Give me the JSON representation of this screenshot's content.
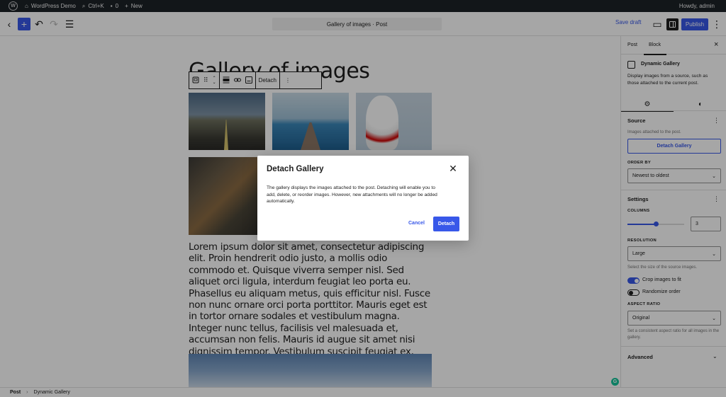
{
  "admin_bar": {
    "site_name": "WordPress Demo",
    "search_shortcut": "Ctrl+K",
    "comments_count": "0",
    "new_label": "New",
    "howdy": "Howdy, admin"
  },
  "header": {
    "document_title": "Gallery of images · Post",
    "save_draft": "Save draft",
    "publish": "Publish"
  },
  "canvas": {
    "post_title": "Gallery of images",
    "toolbar_detach": "Detach",
    "paragraph": "Lorem ipsum dolor sit amet, consectetur adipiscing elit. Proin hendrerit odio justo, a mollis odio commodo et. Quisque viverra semper nisl. Sed aliquet orci ligula, interdum feugiat leo porta eu. Phasellus eu aliquam metus, quis efficitur nisl. Fusce non nunc ornare orci porta porttitor. Mauris eget est in tortor ornare sodales et vestibulum magna. Integer nunc tellus, facilisis vel malesuada et, accumsan non felis. Mauris id augue sit amet nisi dignissim tempor. Vestibulum suscipit feugiat ex, tincidunt cursus neque. Fusce tempus elementum erat ac convallis."
  },
  "modal": {
    "title": "Detach Gallery",
    "body": "The gallery displays the images attached to the post. Detaching will enable you to add, delete, or reorder images. However, new attachments will no longer be added automatically.",
    "cancel": "Cancel",
    "confirm": "Detach"
  },
  "sidebar": {
    "tabs": [
      "Post",
      "Block"
    ],
    "active_tab": "Block",
    "block_name": "Dynamic Gallery",
    "block_description": "Display images from a source, such as those attached to the current post.",
    "source": {
      "title": "Source",
      "help": "Images attached to the post.",
      "detach_button": "Detach Gallery",
      "order_by_label": "ORDER BY",
      "order_by_value": "Newest to oldest"
    },
    "settings": {
      "title": "Settings",
      "columns_label": "COLUMNS",
      "columns_value": "3",
      "columns_fraction": 0.5,
      "resolution_label": "RESOLUTION",
      "resolution_value": "Large",
      "resolution_help": "Select the size of the source images.",
      "crop_label": "Crop images to fit",
      "crop_on": true,
      "randomize_label": "Randomize order",
      "randomize_on": false,
      "aspect_label": "ASPECT RATIO",
      "aspect_value": "Original",
      "aspect_help": "Set a consistent aspect ratio for all images in the gallery."
    },
    "advanced": "Advanced"
  },
  "footer": {
    "crumb_root": "Post",
    "crumb_block": "Dynamic Gallery"
  },
  "colors": {
    "accent": "#3858e9",
    "admin_bar": "#1d2327",
    "text": "#1e1e1e"
  }
}
